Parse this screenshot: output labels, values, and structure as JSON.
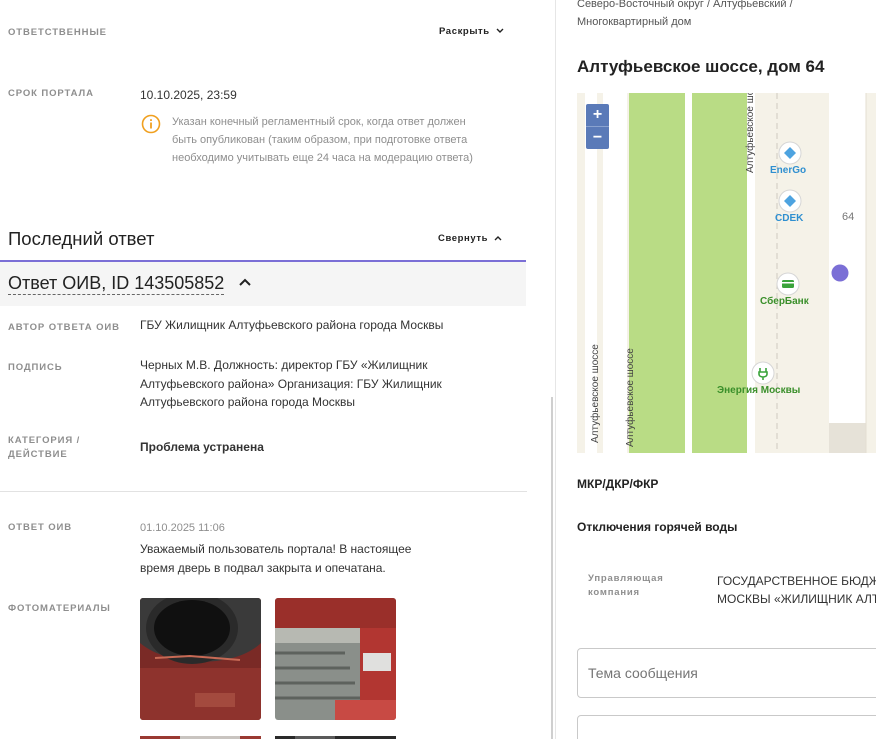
{
  "responsible": {
    "label": "Ответственные",
    "toggle": "Раскрыть"
  },
  "deadline": {
    "label": "Срок портала",
    "value": "10.10.2025, 23:59",
    "info": "Указан конечный регламентный срок, когда ответ должен быть опубликован (таким образом, при подготовке ответа необходимо учитывать еще 24 часа на модерацию ответа)"
  },
  "last_answer": {
    "title": "Последний ответ",
    "toggle": "Свернуть",
    "answer_title": "Ответ ОИВ, ID 143505852",
    "author_label": "Автор ответа ОИВ",
    "author_value": "ГБУ Жилищник Алтуфьевского района города Москвы",
    "signature_label": "Подпись",
    "signature_value": "Черных М.В. Должность: директор ГБУ «Жилищник Алтуфьевского района» Организация: ГБУ Жилищник Алтуфьевского района города Москвы",
    "category_label_1": "Категория /",
    "category_label_2": "действие",
    "category_value": "Проблема устранена",
    "oiv_label": "Ответ ОИВ",
    "oiv_date": "01.10.2025 11:06",
    "oiv_text": "Уважаемый пользователь портала! В настоящее время дверь в подвал закрыта и опечатана.",
    "photos_label": "Фотоматериалы"
  },
  "right": {
    "breadcrumb_1": "Северо-Восточный округ / Алтуфьевский /",
    "breadcrumb_2": "Многоквартирный дом",
    "address": "Алтуфьевское шоссе, дом 64",
    "map": {
      "zoom_in": "+",
      "zoom_out": "−",
      "street": "Алтуфьевское шоссе",
      "house_number": "64",
      "poi": [
        "EnerGo",
        "CDEK",
        "СберБанк",
        "Энергия Москвы"
      ]
    },
    "program": "МКР/ДКР/ФКР",
    "outages": "Отключения горячей воды",
    "mgmt_label_1": "Управляющая",
    "mgmt_label_2": "компания",
    "mgmt_value_1": "ГОСУДАРСТВЕННОЕ БЮДЖ",
    "mgmt_value_2": "МОСКВЫ «ЖИЛИЩНИК АЛТ",
    "subject_placeholder": "Тема сообщения"
  },
  "colors": {
    "accent": "#7b6fd6",
    "map_green": "#b9dc85",
    "map_marker": "#7b6fd6"
  }
}
